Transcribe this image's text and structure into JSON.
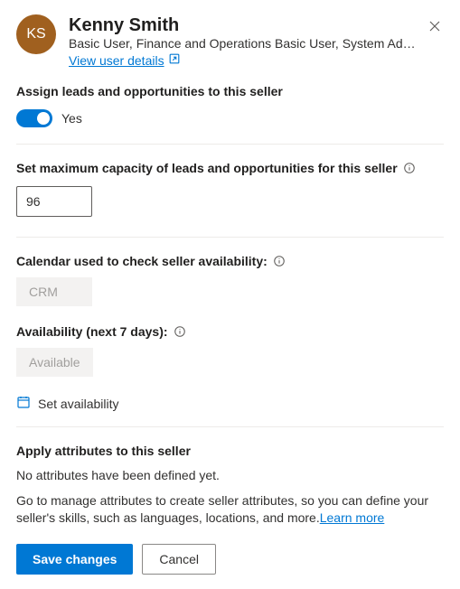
{
  "header": {
    "initials": "KS",
    "name": "Kenny Smith",
    "roles": "Basic User, Finance and Operations Basic User, System Administr…",
    "view_details": "View user details"
  },
  "assign": {
    "label": "Assign leads and opportunities to this seller",
    "toggle_value": "Yes"
  },
  "capacity": {
    "label": "Set maximum capacity of leads and opportunities for this seller",
    "value": "96"
  },
  "calendar": {
    "label": "Calendar used to check seller availability:",
    "value": "CRM"
  },
  "availability": {
    "label": "Availability (next 7 days):",
    "value": "Available",
    "set_label": "Set availability"
  },
  "attributes": {
    "heading": "Apply attributes to this seller",
    "empty": "No attributes have been defined yet.",
    "desc": "Go to manage attributes to create seller attributes, so you can define your seller's skills, such as languages, locations, and more.",
    "learn_more": "Learn more"
  },
  "footer": {
    "save": "Save changes",
    "cancel": "Cancel"
  }
}
